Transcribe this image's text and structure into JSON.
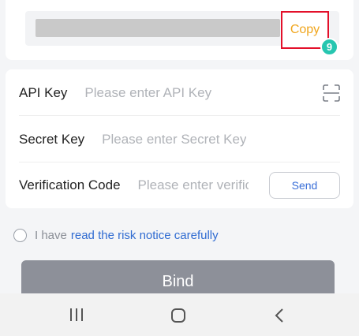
{
  "key_section": {
    "copy_label": "Copy",
    "step_badge": "9"
  },
  "form": {
    "api_key": {
      "label": "API Key",
      "placeholder": "Please enter API Key",
      "icon": "scan-icon"
    },
    "secret_key": {
      "label": "Secret Key",
      "placeholder": "Please enter Secret Key"
    },
    "verification": {
      "label": "Verification Code",
      "placeholder": "Please enter verification code",
      "send_label": "Send"
    }
  },
  "risk": {
    "prefix": "I have",
    "link": "read the risk notice carefully"
  },
  "bind_label": "Bind",
  "navbar": {
    "icons": [
      "recent-apps-icon",
      "home-icon",
      "back-icon"
    ]
  },
  "colors": {
    "copy_text": "#f0a51c",
    "copy_border": "#e3102a",
    "badge": "#26c6b0",
    "link": "#2f6bd1",
    "bind_bg": "#8d9099"
  }
}
